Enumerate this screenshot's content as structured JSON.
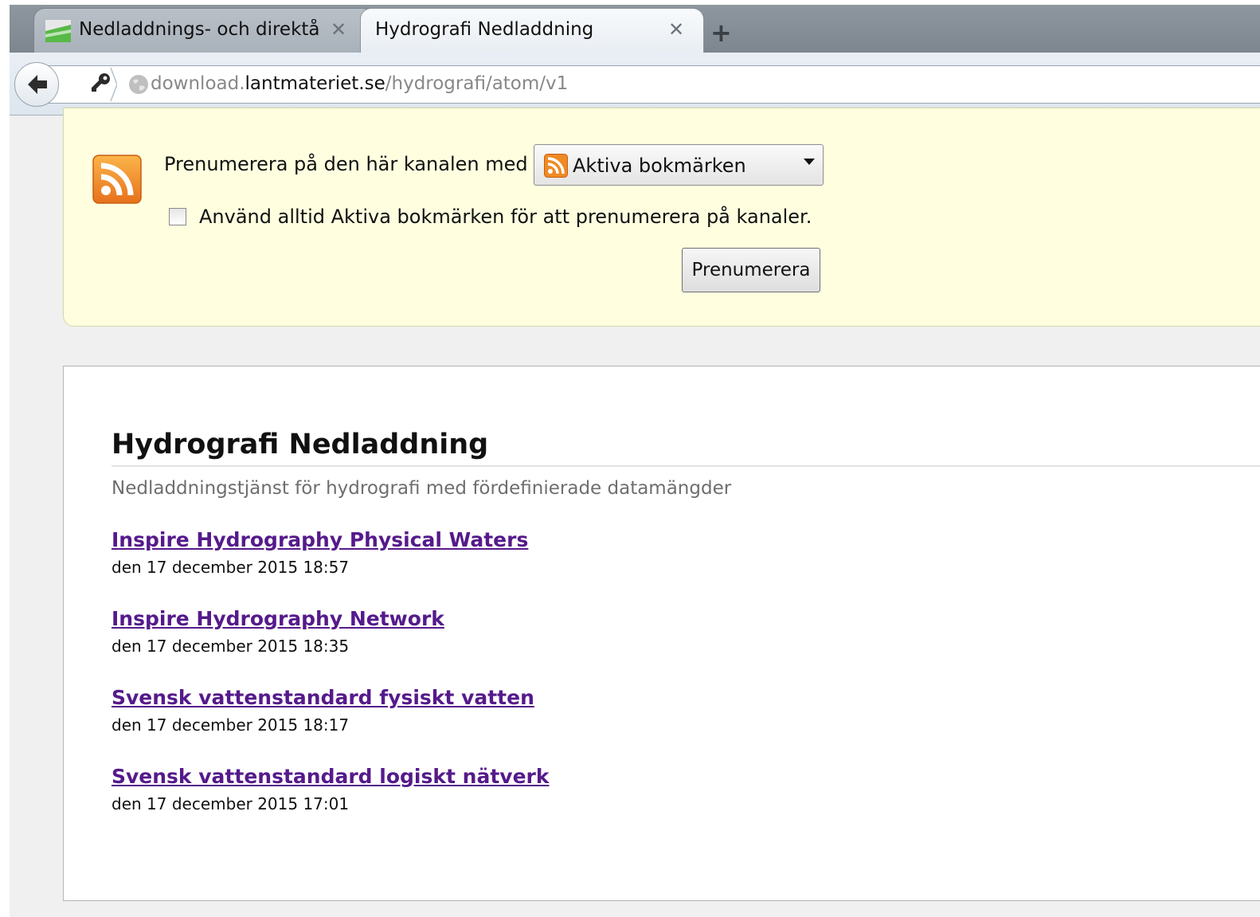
{
  "tabs": [
    {
      "label": "Nedladdnings- och direktå...",
      "active": false
    },
    {
      "label": "Hydrografi Nedladdning",
      "active": true
    }
  ],
  "nav": {
    "url_prefix": "download.",
    "url_domain": "lantmateriet.se",
    "url_path": "/hydrografi/atom/v1"
  },
  "subscribe": {
    "prompt": "Prenumerera på den här kanalen med",
    "reader": "Aktiva bokmärken",
    "always_label": "Använd alltid Aktiva bokmärken för att prenumerera på kanaler.",
    "always_checked": false,
    "button_label": "Prenumerera"
  },
  "feed": {
    "title": "Hydrografi Nedladdning",
    "subtitle": "Nedladdningstjänst för hydrografi med fördefinierade datamängder",
    "entries": [
      {
        "title": "Inspire Hydrography Physical Waters",
        "date": "den 17 december 2015 18:57"
      },
      {
        "title": "Inspire Hydrography Network",
        "date": "den 17 december 2015 18:35"
      },
      {
        "title": "Svensk vattenstandard fysiskt vatten",
        "date": "den 17 december 2015 18:17"
      },
      {
        "title": "Svensk vattenstandard logiskt nätverk",
        "date": "den 17 december 2015 17:01"
      }
    ]
  },
  "colors": {
    "link_visited": "#551a8b",
    "subscribe_bg": "#ffffe0",
    "rss_orange": "#f7931e"
  }
}
